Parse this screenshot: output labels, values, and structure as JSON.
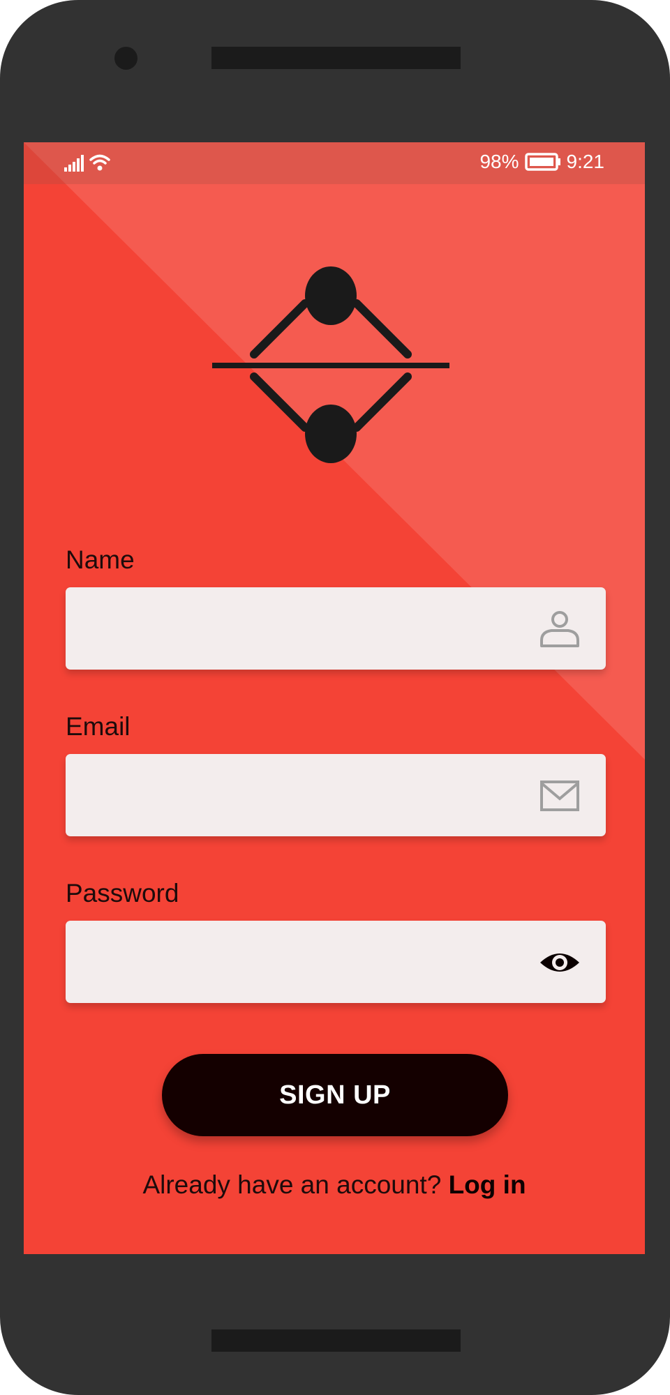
{
  "status_bar": {
    "battery_percent": "98%",
    "time": "9:21",
    "icons": [
      "signal-icon",
      "wifi-icon",
      "battery-icon"
    ]
  },
  "logo": {
    "icon": "logo-icon"
  },
  "form": {
    "name": {
      "label": "Name",
      "value": "",
      "icon": "user-icon"
    },
    "email": {
      "label": "Email",
      "value": "",
      "icon": "mail-icon"
    },
    "password": {
      "label": "Password",
      "value": "",
      "icon": "eye-icon"
    }
  },
  "signup_button": {
    "label": "SIGN UP"
  },
  "login_prompt": {
    "text": "Already have an account?",
    "link": "Log in"
  },
  "colors": {
    "background": "#f44336",
    "field": "#f3eded",
    "button": "#140000",
    "device": "#323232"
  }
}
